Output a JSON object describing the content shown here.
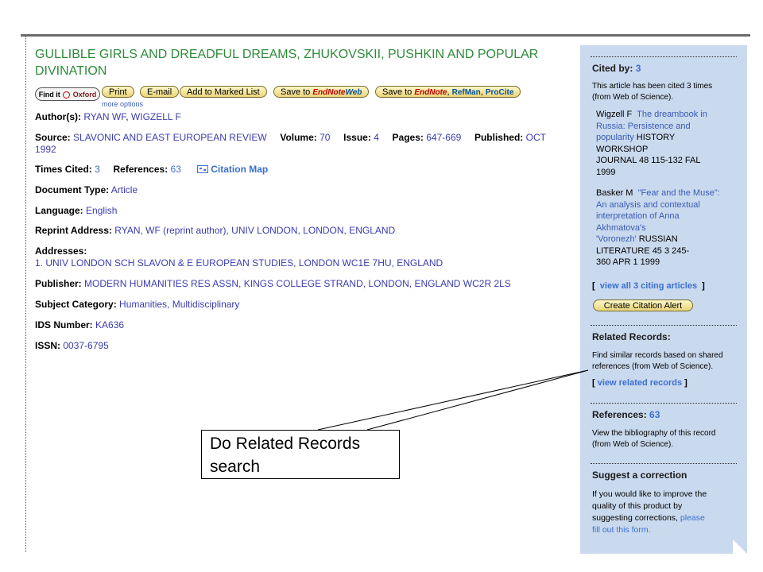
{
  "article": {
    "title": "GULLIBLE GIRLS AND DREADFUL DREAMS, ZHUKOVSKII, PUSHKIN AND POPULAR DIVINATION"
  },
  "toolbar": {
    "findit_prefix": "Find it",
    "findit_brand": "Oxford",
    "print": "Print",
    "email": "E-mail",
    "marked_list": "Add to Marked List",
    "save_endnote_web_prefix": "Save to",
    "save_endnote_web_brand": "EndNote",
    "save_endnote_web_suffix": "Web",
    "save_endnote_prefix": "Save to",
    "save_endnote_brand": "EndNote",
    "save_refman": "RefMan",
    "save_procite": "ProCite",
    "more_options": "more options"
  },
  "record": {
    "authors_label": "Author(s):",
    "authors": [
      "RYAN WF",
      "WIGZELL F"
    ],
    "source_label": "Source:",
    "source": "SLAVONIC AND EAST EUROPEAN REVIEW",
    "volume_label": "Volume:",
    "volume": "70",
    "issue_label": "Issue:",
    "issue": "4",
    "pages_label": "Pages:",
    "pages": "647-669",
    "published_label": "Published:",
    "published_1": "OCT",
    "published_2": "1992",
    "times_cited_label": "Times Cited:",
    "times_cited": "3",
    "references_label": "References:",
    "references": "63",
    "citation_map": "Citation Map",
    "doctype_label": "Document Type:",
    "doctype": "Article",
    "language_label": "Language:",
    "language": "English",
    "reprint_label": "Reprint Address:",
    "reprint": "RYAN, WF (reprint author), UNIV LONDON, LONDON, ENGLAND",
    "addresses_label": "Addresses:",
    "address_1": "1. UNIV LONDON SCH SLAVON & E EUROPEAN STUDIES, LONDON WC1E 7HU, ENGLAND",
    "publisher_label": "Publisher:",
    "publisher": "MODERN HUMANITIES RES ASSN, KINGS COLLEGE STRAND, LONDON, ENGLAND WC2R 2LS",
    "subject_label": "Subject Category:",
    "subject": "Humanities, Multidisciplinary",
    "ids_label": "IDS Number:",
    "ids": "KA636",
    "issn_label": "ISSN:",
    "issn": "0037-6795"
  },
  "sidebar": {
    "cited_by_label": "Cited by:",
    "cited_by_count": "3",
    "cited_by_desc_1": "This article has been cited 3 times",
    "cited_by_desc_2": "(from Web of Science).",
    "cite1": {
      "author": "Wigzell F",
      "title_1": "The dreambook in",
      "title_2": "Russia: Persistence and",
      "title_3": "popularity",
      "source_1": "HISTORY",
      "source_2": "WORKSHOP",
      "source_3": "JOURNAL  48  115-132  FAL",
      "source_4": "1999"
    },
    "cite2": {
      "author": "Basker M",
      "title_1": "\"Fear and the Muse\":",
      "title_2": "An analysis and contextual",
      "title_3": "interpretation of Anna",
      "title_4": "Akhmatova's",
      "title_5": "'Voronezh'",
      "source_1": "RUSSIAN",
      "source_2": "LITERATURE  45  3  245-",
      "source_3": "360  APR 1 1999"
    },
    "view_all": "view all 3 citing articles",
    "create_alert": "Create Citation Alert",
    "related_label": "Related Records:",
    "related_desc_1": "Find similar records based on shared",
    "related_desc_2": "references (from Web of Science).",
    "view_related": "view related records",
    "references_label": "References:",
    "references_count": "63",
    "references_desc_1": "View the bibliography of this record",
    "references_desc_2": "(from Web of Science).",
    "suggest_label": "Suggest a correction",
    "suggest_1": "If you would like to improve the",
    "suggest_2": "quality of this product by",
    "suggest_3": "suggesting corrections,",
    "suggest_link_1": "please",
    "suggest_link_2": "fill out this form."
  },
  "callout": {
    "text_1": "Do Related Records",
    "text_2": "search"
  },
  "colors": {
    "title_green": "#2e8b3a",
    "link_blue": "#3b6fd0",
    "sidebar_bg": "#c9d9ee"
  }
}
